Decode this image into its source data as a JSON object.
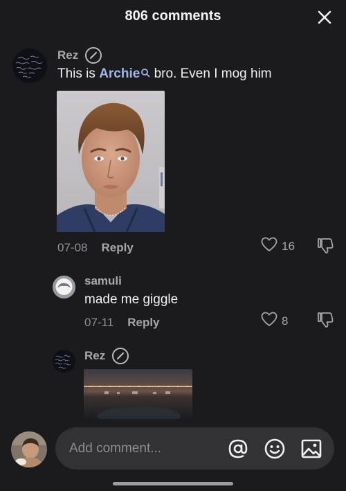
{
  "header": {
    "title": "806 comments"
  },
  "comments": [
    {
      "username": "Rez",
      "text_before": "This is ",
      "mention": "Archie",
      "text_after": " bro. Even I mog him",
      "date": "07-08",
      "reply_label": "Reply",
      "likes": "16"
    },
    {
      "username": "samuli",
      "text": "made me giggle",
      "date": "07-11",
      "reply_label": "Reply",
      "likes": "8"
    },
    {
      "username": "Rez"
    }
  ],
  "composer": {
    "placeholder": "Add comment..."
  },
  "icons": {
    "close": "close-icon",
    "verified": "verified-icon",
    "like": "heart-icon",
    "dislike": "dislike-icon",
    "mention": "at-icon",
    "emoji": "emoji-icon",
    "image": "image-icon"
  },
  "colors": {
    "background": "#1b1b1d",
    "mention": "#9fb6e6",
    "input_bg": "#323235"
  }
}
